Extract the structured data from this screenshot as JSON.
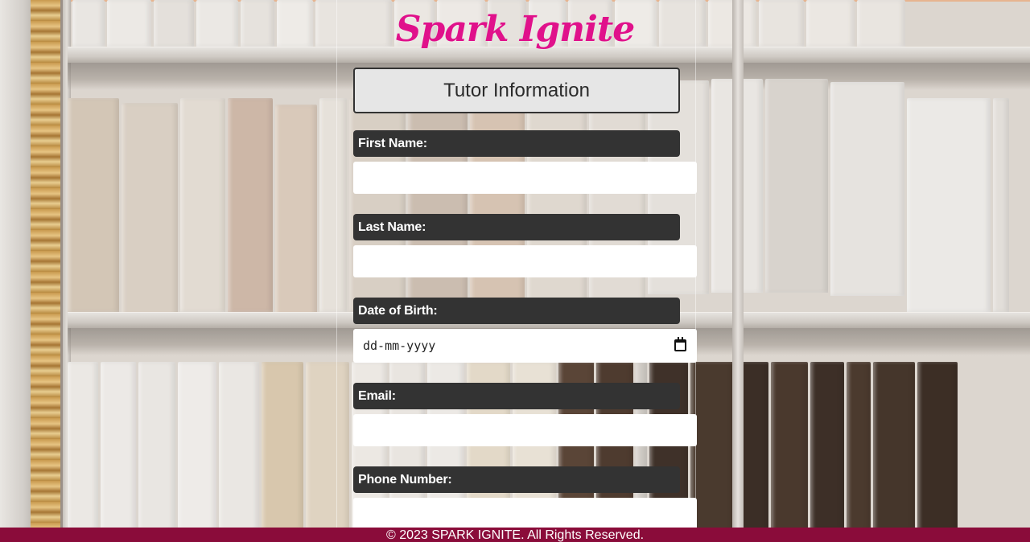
{
  "brand": {
    "name": "Spark Ignite",
    "color": "#e0118b"
  },
  "form": {
    "title": "Tutor Information",
    "fields": [
      {
        "label": "First Name:",
        "value": ""
      },
      {
        "label": "Last Name:",
        "value": ""
      },
      {
        "label": "Date of Birth:",
        "value": "",
        "placeholder": "dd-mm-yyyy",
        "icon": "calendar-icon"
      },
      {
        "label": "Email:",
        "value": ""
      },
      {
        "label": "Phone Number:",
        "value": ""
      }
    ]
  },
  "footer": {
    "text": "© 2023 SPARK IGNITE. All Rights Reserved.",
    "background": "#8a0c3a"
  },
  "colors": {
    "label_bg": "#333333",
    "title_bg": "#e6e6e6"
  }
}
